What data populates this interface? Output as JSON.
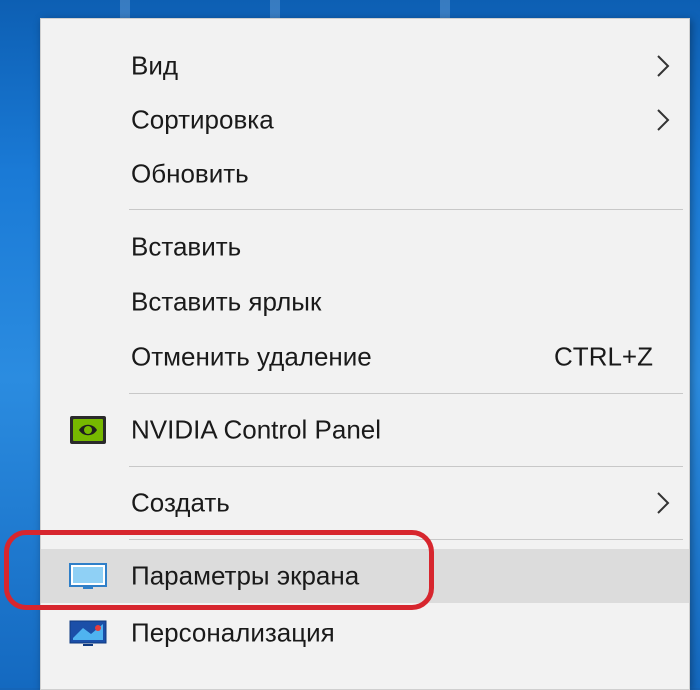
{
  "context_menu": {
    "items": [
      {
        "label": "Вид",
        "has_submenu": true
      },
      {
        "label": "Сортировка",
        "has_submenu": true
      },
      {
        "label": "Обновить"
      },
      {
        "label": "Вставить"
      },
      {
        "label": "Вставить ярлык"
      },
      {
        "label": "Отменить удаление",
        "shortcut": "CTRL+Z"
      },
      {
        "label": "NVIDIA Control Panel",
        "icon": "nvidia-icon"
      },
      {
        "label": "Создать",
        "has_submenu": true
      },
      {
        "label": "Параметры экрана",
        "icon": "display-settings-icon",
        "highlighted": true
      },
      {
        "label": "Персонализация",
        "icon": "personalization-icon"
      }
    ]
  },
  "colors": {
    "highlight_ring": "#d7262e",
    "menu_background": "#f2f2f2",
    "hover_background": "#dcdcdc",
    "nvidia_green": "#76b900"
  }
}
